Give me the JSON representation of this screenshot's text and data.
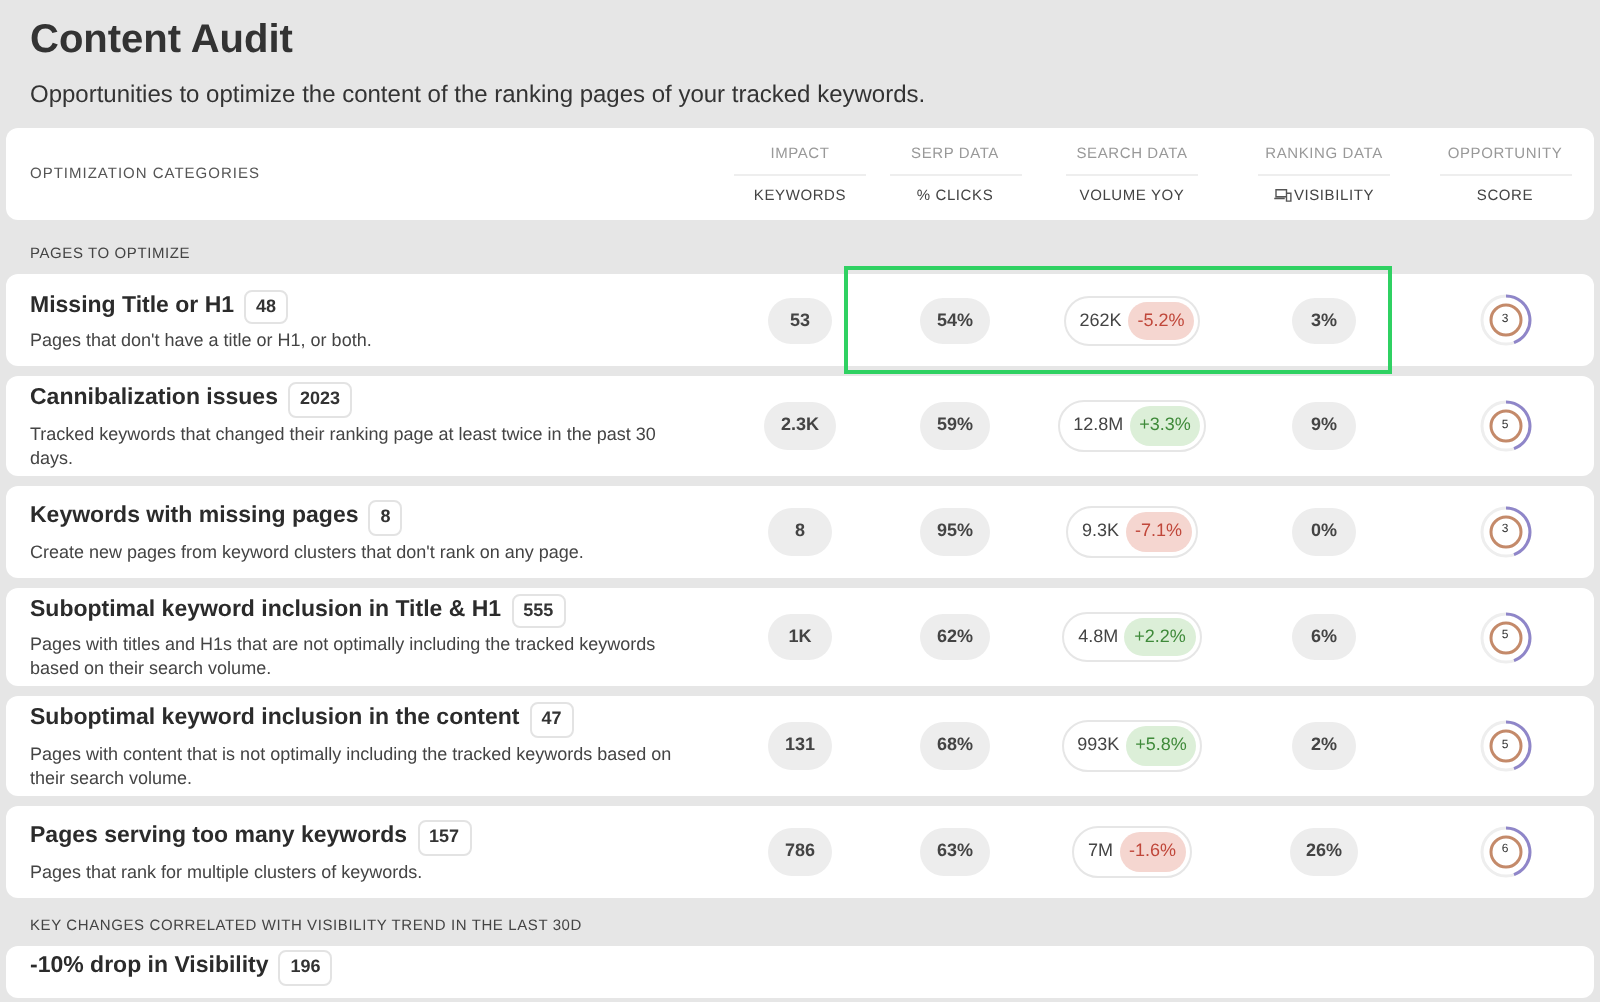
{
  "title": "Content Audit",
  "subtitle": "Opportunities to optimize the content of the ranking pages of your tracked keywords.",
  "header": {
    "category": "OPTIMIZATION CATEGORIES",
    "columns": [
      {
        "group": "IMPACT",
        "label": "KEYWORDS"
      },
      {
        "group": "SERP DATA",
        "label": "% CLICKS"
      },
      {
        "group": "SEARCH DATA",
        "label": "VOLUME YOY"
      },
      {
        "group": "RANKING DATA",
        "label": "VISIBILITY"
      },
      {
        "group": "OPPORTUNITY",
        "label": "SCORE"
      }
    ]
  },
  "sections": [
    {
      "label": "PAGES TO OPTIMIZE",
      "rows": [
        {
          "title": "Missing Title or H1",
          "count": "48",
          "description": "Pages that don't have a title or H1, or both.",
          "keywords": "53",
          "clicks": "54%",
          "volume": "262K",
          "yoy": "-5.2%",
          "negative": true,
          "visibility": "3%",
          "score": "3",
          "highlighted": true
        },
        {
          "title": "Cannibalization issues",
          "count": "2023",
          "description": "Tracked keywords that changed their ranking page at least twice in the past 30 days.",
          "keywords": "2.3K",
          "clicks": "59%",
          "volume": "12.8M",
          "yoy": "+3.3%",
          "negative": false,
          "visibility": "9%",
          "score": "5",
          "highlighted": false
        },
        {
          "title": "Keywords with missing pages",
          "count": "8",
          "description": "Create new pages from keyword clusters that don't rank on any page.",
          "keywords": "8",
          "clicks": "95%",
          "volume": "9.3K",
          "yoy": "-7.1%",
          "negative": true,
          "visibility": "0%",
          "score": "3",
          "highlighted": false
        },
        {
          "title": "Suboptimal keyword inclusion in Title & H1",
          "count": "555",
          "description": "Pages with titles and H1s that are not optimally including the tracked keywords based on their search volume.",
          "keywords": "1K",
          "clicks": "62%",
          "volume": "4.8M",
          "yoy": "+2.2%",
          "negative": false,
          "visibility": "6%",
          "score": "5",
          "highlighted": false
        },
        {
          "title": "Suboptimal keyword inclusion in the content",
          "count": "47",
          "description": "Pages with content that is not optimally including the tracked keywords based on their search volume.",
          "keywords": "131",
          "clicks": "68%",
          "volume": "993K",
          "yoy": "+5.8%",
          "negative": false,
          "visibility": "2%",
          "score": "5",
          "highlighted": false
        },
        {
          "title": "Pages serving too many keywords",
          "count": "157",
          "description": "Pages that rank for multiple clusters of keywords.",
          "keywords": "786",
          "clicks": "63%",
          "volume": "7M",
          "yoy": "-1.6%",
          "negative": true,
          "visibility": "26%",
          "score": "6",
          "highlighted": false
        }
      ]
    },
    {
      "label": "KEY CHANGES CORRELATED WITH VISIBILITY TREND IN THE LAST 30D",
      "rows": [
        {
          "title": "-10% drop in Visibility",
          "count": "196"
        }
      ]
    }
  ]
}
